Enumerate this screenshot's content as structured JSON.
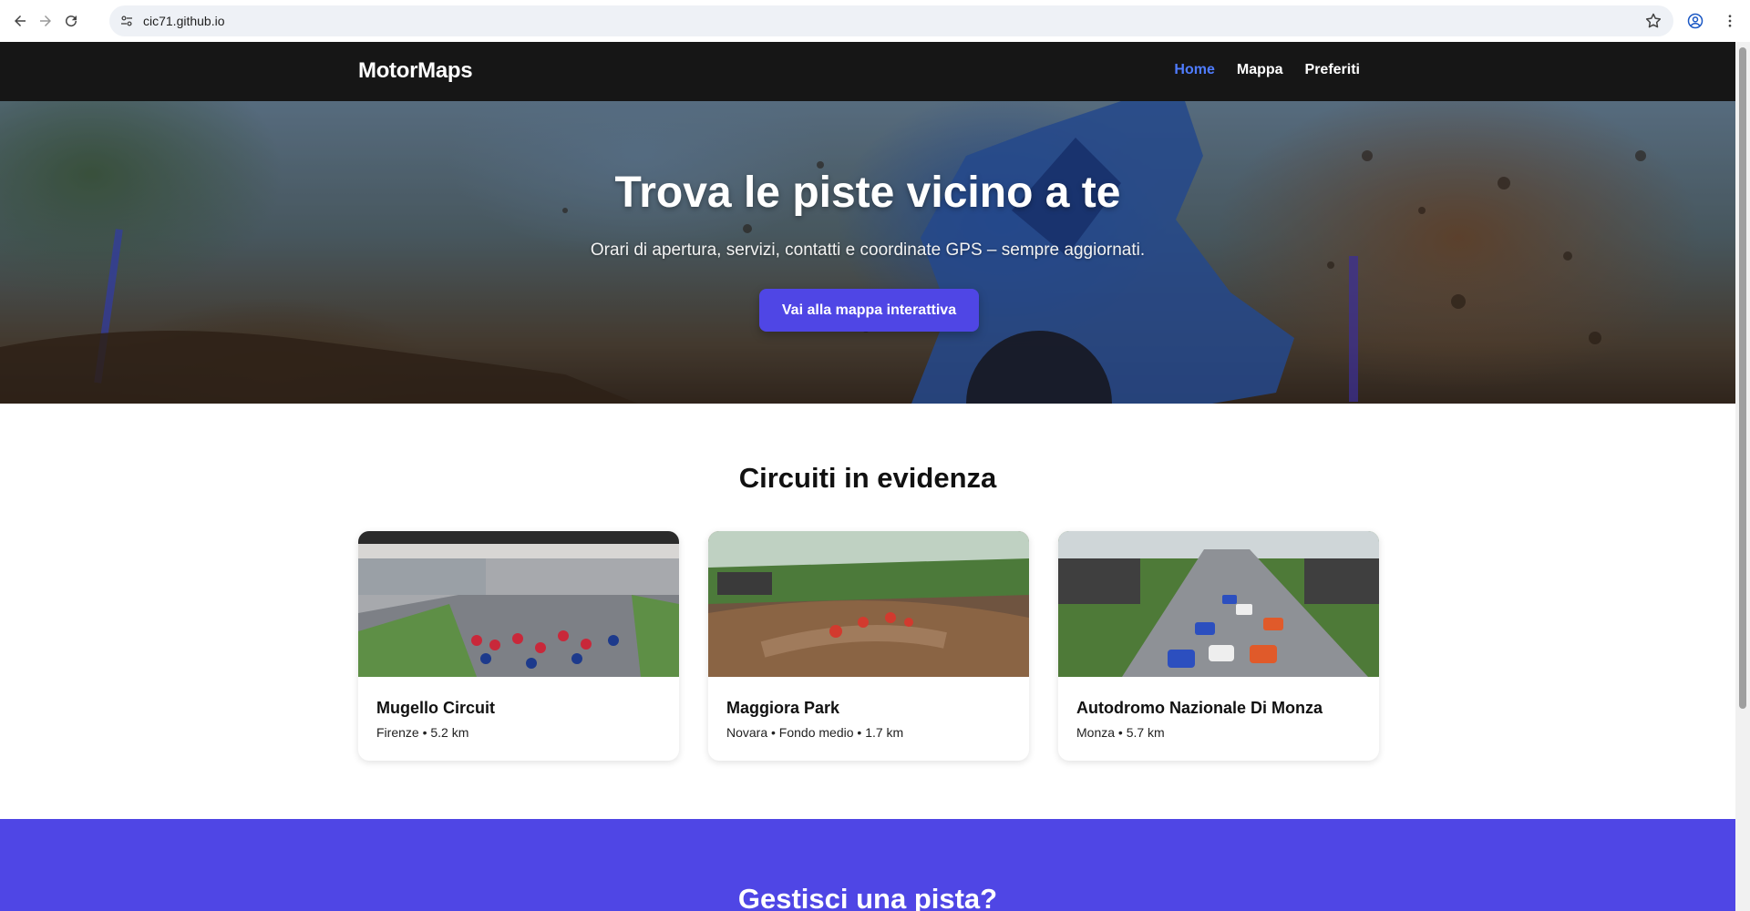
{
  "browser": {
    "url": "cic71.github.io",
    "icons": [
      "back-arrow-icon",
      "forward-arrow-icon",
      "reload-icon",
      "site-settings-icon",
      "bookmark-star-icon",
      "profile-icon",
      "more-menu-icon"
    ]
  },
  "site": {
    "brand": "MotorMaps",
    "nav": {
      "home": "Home",
      "map": "Mappa",
      "favorites": "Preferiti"
    },
    "accent_color": "#4f46e5",
    "active_nav_color": "#4f7cff"
  },
  "hero": {
    "title": "Trova le piste vicino a te",
    "subtitle": "Orari di apertura, servizi, contatti e coordinate GPS – sempre aggiornati.",
    "cta_label": "Vai alla mappa interattiva"
  },
  "featured": {
    "title": "Circuiti in evidenza",
    "cards": [
      {
        "name": "Mugello Circuit",
        "meta": "Firenze • 5.2 km"
      },
      {
        "name": "Maggiora Park",
        "meta": "Novara • Fondo medio • 1.7 km"
      },
      {
        "name": "Autodromo Nazionale Di Monza",
        "meta": "Monza • 5.7 km"
      }
    ]
  },
  "cta_section": {
    "title": "Gestisci una pista?"
  }
}
